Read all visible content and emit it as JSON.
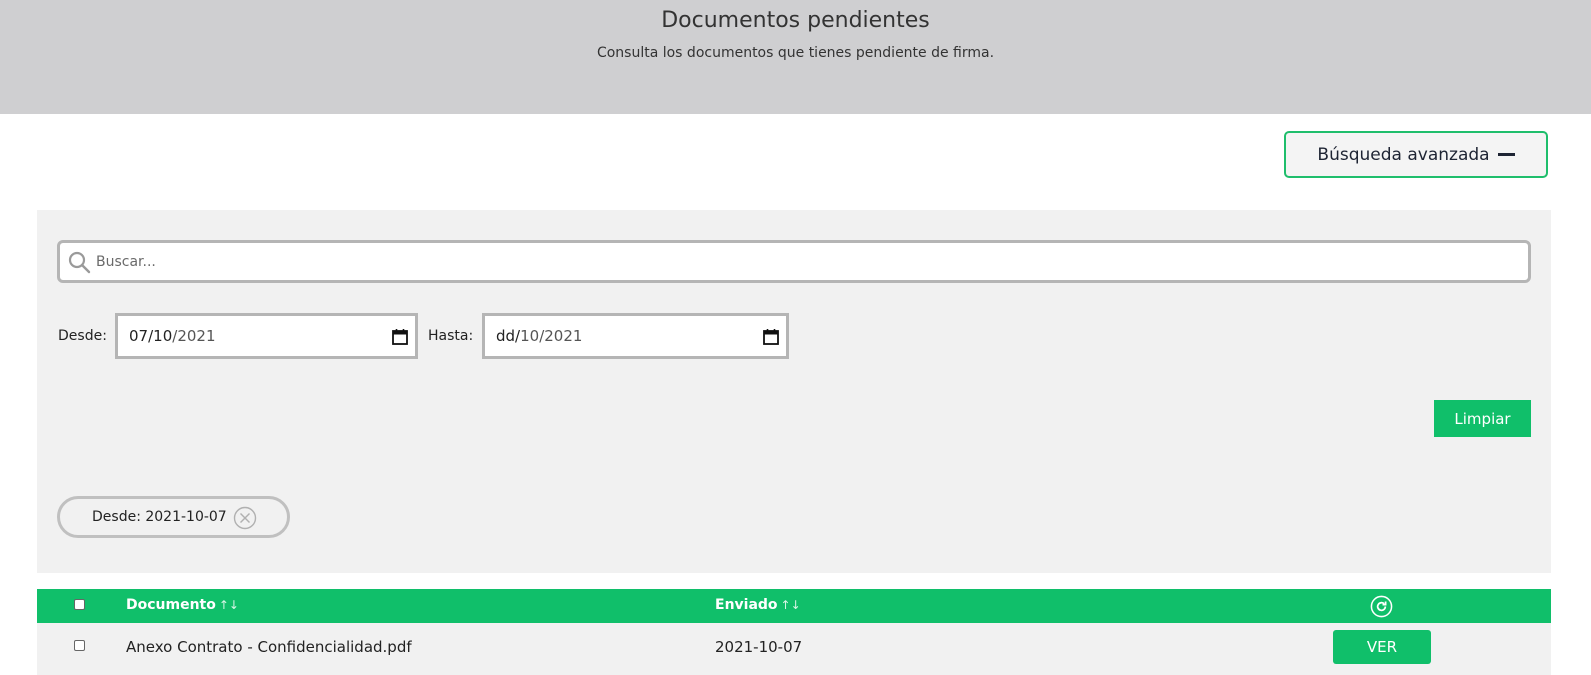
{
  "header": {
    "title": "Documentos pendientes",
    "subtitle": "Consulta los documentos que tienes pendiente de firma."
  },
  "advanced_search": {
    "label": "Búsqueda avanzada"
  },
  "filters": {
    "search_placeholder": "Buscar...",
    "from_label": "Desde:",
    "from_value": {
      "day": "07",
      "month": "10",
      "year": "2021"
    },
    "to_label": "Hasta:",
    "to_value": {
      "day": "dd",
      "month": "10",
      "year": "2021"
    },
    "clear_label": "Limpiar",
    "active_chip": "Desde: 2021-10-07"
  },
  "table": {
    "columns": [
      {
        "label": "Documento",
        "sort_icon": "↑↓"
      },
      {
        "label": "Enviado",
        "sort_icon": "↑↓"
      }
    ],
    "rows": [
      {
        "document": "Anexo Contrato - Confidencialidad.pdf",
        "sent": "2021-10-07",
        "action": "VER"
      }
    ]
  },
  "icons": {
    "search": "search-icon",
    "calendar": "calendar-icon",
    "chip_remove": "close-circle-icon",
    "refresh": "refresh-icon",
    "collapse": "minus-icon"
  },
  "colors": {
    "accent": "#10bf6a",
    "header_bg": "#cfcfd1",
    "panel_bg": "#f1f1f1",
    "border_grey": "#b5b5b5"
  }
}
